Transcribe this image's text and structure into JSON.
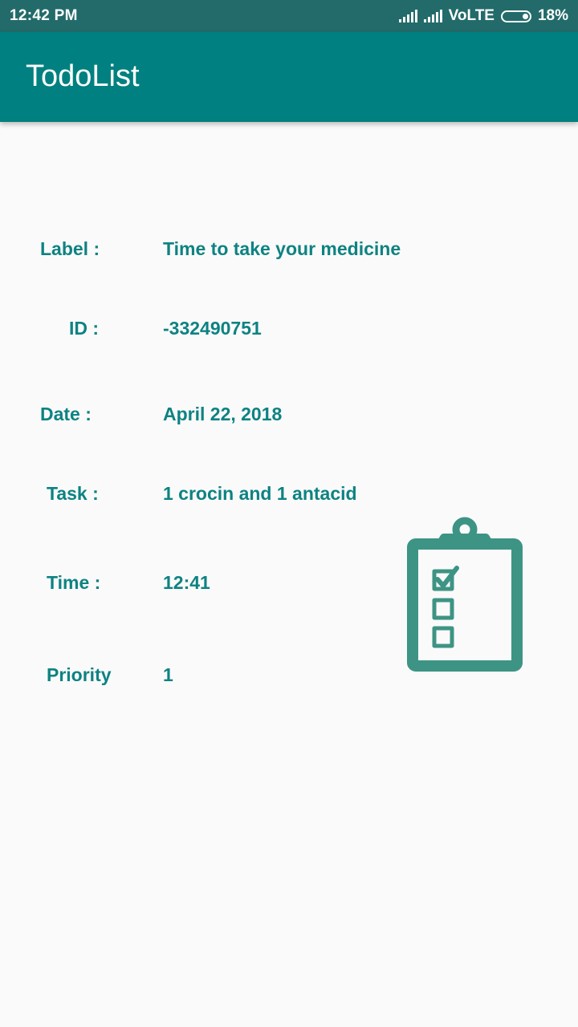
{
  "status_bar": {
    "time": "12:42 PM",
    "network": "VoLTE",
    "battery": "18%",
    "icons": [
      "signal-icon",
      "signal-icon",
      "battery-icon"
    ]
  },
  "app_bar": {
    "title": "TodoList"
  },
  "details": {
    "label": {
      "name": "Label :",
      "value": "Time to take your medicine"
    },
    "id": {
      "name": "ID :",
      "value": "-332490751"
    },
    "date": {
      "name": "Date :",
      "value": "April 22, 2018"
    },
    "task": {
      "name": "Task :",
      "value": "1 crocin and 1 antacid"
    },
    "time": {
      "name": "Time :",
      "value": "12:41"
    },
    "priority": {
      "name": "Priority",
      "value": "1"
    }
  },
  "illustration": {
    "icon": "clipboard-checklist-icon",
    "color": "#3d9484"
  },
  "colors": {
    "status_bar": "#226b6a",
    "app_bar": "#008080",
    "text_accent": "#0e8282",
    "background": "#fafafa"
  }
}
